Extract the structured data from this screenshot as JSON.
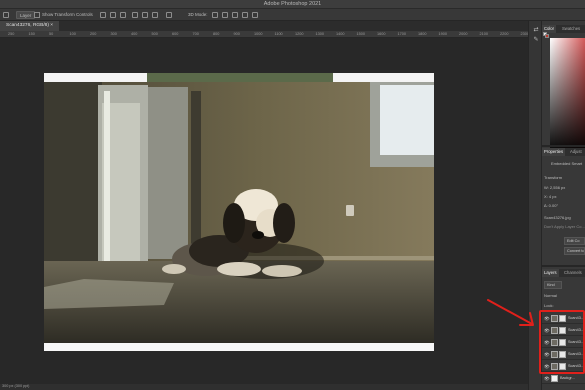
{
  "window": {
    "title": "Adobe Photoshop 2021"
  },
  "options_bar": {
    "auto_select_label": "Layer",
    "show_transform_label": "Show Transform Controls",
    "mode_label": "3D Mode:"
  },
  "document": {
    "tab_label": "Scan43276, RGB/8) ×"
  },
  "ruler": {
    "ticks": [
      "250",
      "150",
      "50",
      "100",
      "200",
      "300",
      "400",
      "500",
      "600",
      "700",
      "800",
      "900",
      "1000",
      "1100",
      "1200",
      "1300",
      "1400",
      "1500",
      "1600",
      "1700",
      "1800",
      "1900",
      "2000",
      "2100",
      "2200",
      "2300"
    ]
  },
  "status_bar": {
    "text": "300 px (300 ppi)"
  },
  "panels": {
    "color_tabs": [
      "Color",
      "Swatches"
    ],
    "properties_tabs": [
      "Properties",
      "Adjust"
    ],
    "properties": {
      "type_label": "Embedded Smart",
      "transform_label": "Transform",
      "w_label": "W: 2,556 px",
      "x_label": "X: 4 px",
      "angle_label": "∆: 0.00°",
      "file_label": "Scan43276.jpg",
      "layer_comp_label": "Don't Apply Layer Co...",
      "edit_button": "Edit Co",
      "convert_button": "Convert to"
    },
    "layers_tabs": [
      "Layers",
      "Channels"
    ],
    "layers_kind": "Kind",
    "blend_mode": "Normal",
    "lock_label": "Lock:",
    "layers": [
      {
        "name": "Scan43...",
        "visible": true
      },
      {
        "name": "Scan43...",
        "visible": true
      },
      {
        "name": "Scan43...",
        "visible": true
      },
      {
        "name": "Scan43...",
        "visible": true
      },
      {
        "name": "Scan43...",
        "visible": true
      },
      {
        "name": "Backgr...",
        "visible": true
      }
    ]
  },
  "annotation": {
    "highlight_color": "#e0201b"
  }
}
